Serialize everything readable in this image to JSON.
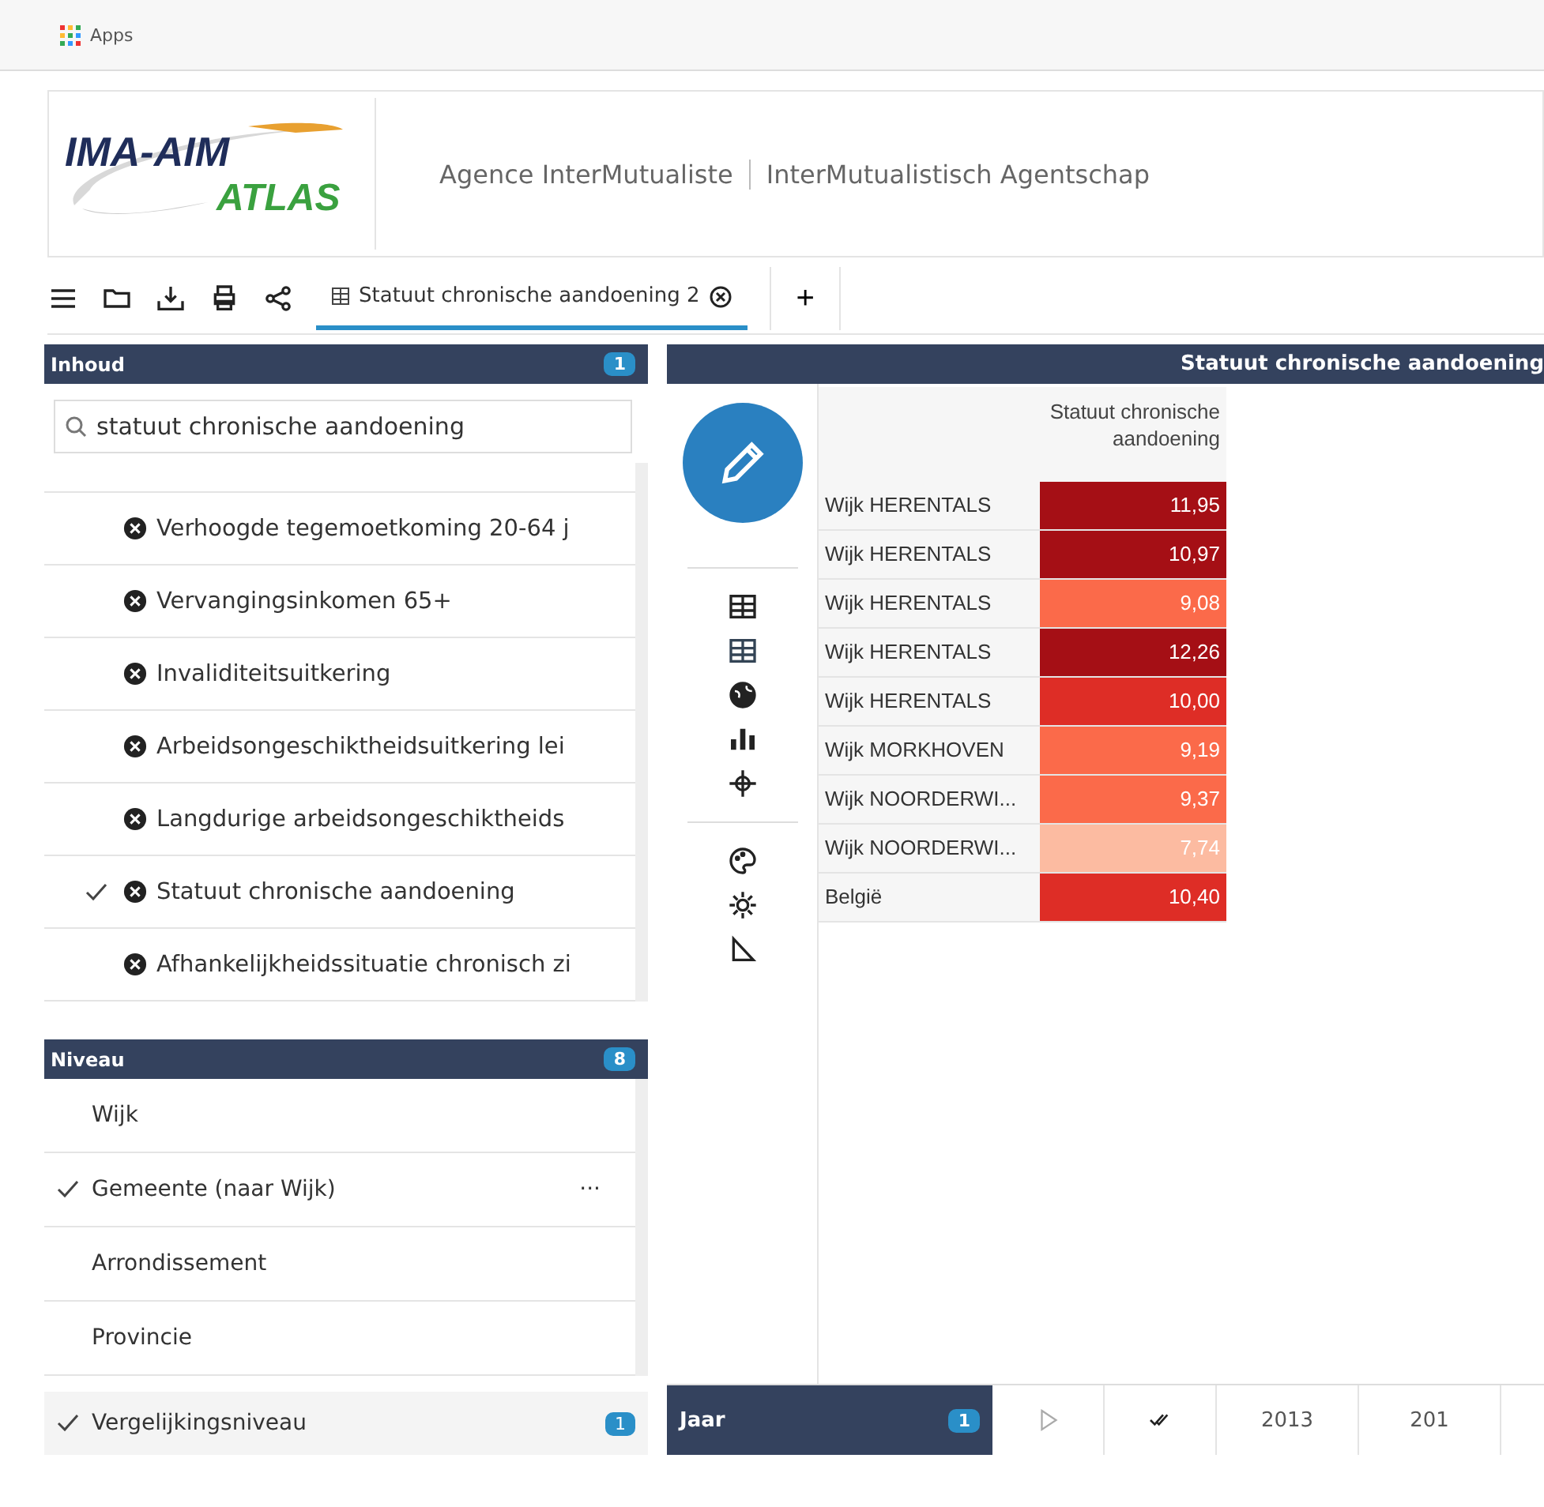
{
  "bookmarks_bar": {
    "apps_label": "Apps"
  },
  "header": {
    "logo_top": "IMA-AIM",
    "logo_bottom": "ATLAS",
    "org_fr": "Agence InterMutualiste",
    "org_nl": "InterMutualistisch Agentschap"
  },
  "toolbar": {
    "tabs": [
      {
        "label": "Statuut chronische aandoening 2",
        "selected": true
      }
    ],
    "add_label": "+"
  },
  "content_panel": {
    "title": "Inhoud",
    "count": "1",
    "search": {
      "value": "statuut chronische aandoening"
    },
    "items": [
      {
        "label": "Verhoogde tegemoetkoming 20-64 j",
        "checked": false
      },
      {
        "label": "Vervangingsinkomen 65+",
        "checked": false
      },
      {
        "label": "Invaliditeitsuitkering",
        "checked": false
      },
      {
        "label": "Arbeidsongeschiktheidsuitkering lei",
        "checked": false
      },
      {
        "label": "Langdurige arbeidsongeschiktheids",
        "checked": false
      },
      {
        "label": "Statuut chronische aandoening",
        "checked": true
      },
      {
        "label": "Afhankelijkheidssituatie chronisch zi",
        "checked": false
      }
    ]
  },
  "level_panel": {
    "title": "Niveau",
    "count": "8",
    "items": [
      {
        "label": "Wijk",
        "checked": false
      },
      {
        "label": "Gemeente (naar Wijk)",
        "checked": true,
        "more": "···"
      },
      {
        "label": "Arrondissement",
        "checked": false
      },
      {
        "label": "Provincie",
        "checked": false
      }
    ],
    "comparison": {
      "label": "Vergelijkingsniveau",
      "checked": true,
      "count": "1"
    }
  },
  "view": {
    "title": "Statuut chronische aandoening",
    "table": {
      "column_header": "Statuut chronische aandoening",
      "rows": [
        {
          "name": "Wijk HERENTALS",
          "value": "11,95",
          "color": "#a50f15"
        },
        {
          "name": "Wijk HERENTALS",
          "value": "10,97",
          "color": "#a50f15"
        },
        {
          "name": "Wijk HERENTALS",
          "value": "9,08",
          "color": "#fb6a4a"
        },
        {
          "name": "Wijk HERENTALS",
          "value": "12,26",
          "color": "#a50f15"
        },
        {
          "name": "Wijk HERENTALS",
          "value": "10,00",
          "color": "#de2d26"
        },
        {
          "name": "Wijk MORKHOVEN",
          "value": "9,19",
          "color": "#fb6a4a"
        },
        {
          "name": "Wijk NOORDERWI...",
          "value": "9,37",
          "color": "#fb6a4a"
        },
        {
          "name": "Wijk NOORDERWI...",
          "value": "7,74",
          "color": "#fcbba1"
        },
        {
          "name": "België",
          "value": "10,40",
          "color": "#de2d26"
        }
      ]
    }
  },
  "time_bar": {
    "title": "Jaar",
    "count": "1",
    "years": [
      "2013",
      "201"
    ]
  }
}
